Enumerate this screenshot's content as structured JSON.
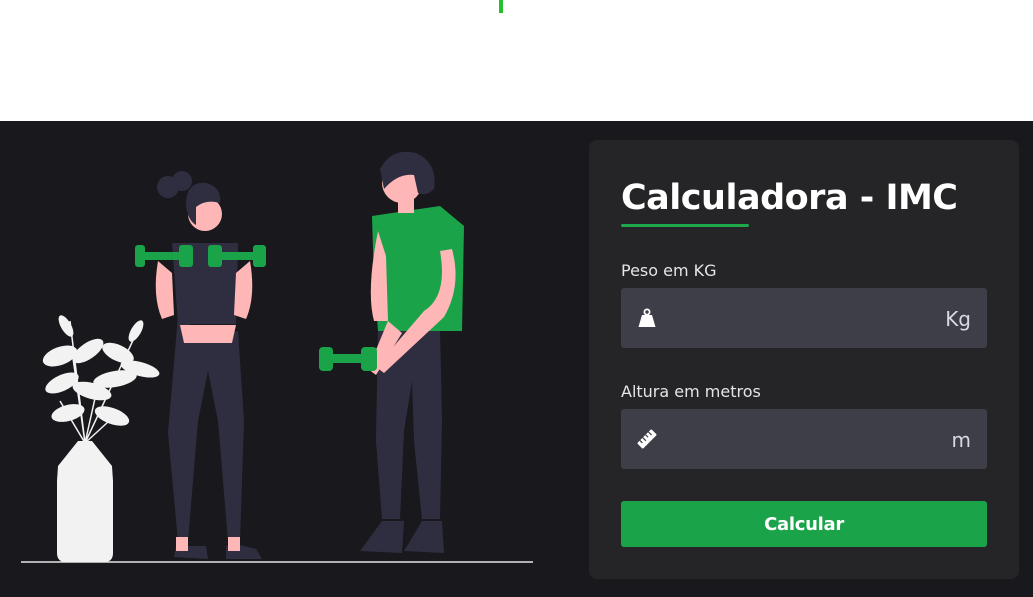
{
  "colors": {
    "accent": "#1ba34a",
    "background": "#19181c",
    "card": "#252527",
    "input": "#3d3e47",
    "top_marker": "#22c02b"
  },
  "card": {
    "title": "Calculadora - IMC"
  },
  "weight_field": {
    "label": "Peso em KG",
    "value": "",
    "unit": "Kg",
    "icon": "weight-icon"
  },
  "height_field": {
    "label": "Altura em metros",
    "value": "",
    "unit": "m",
    "icon": "ruler-icon"
  },
  "calculate_button": {
    "label": "Calcular"
  }
}
